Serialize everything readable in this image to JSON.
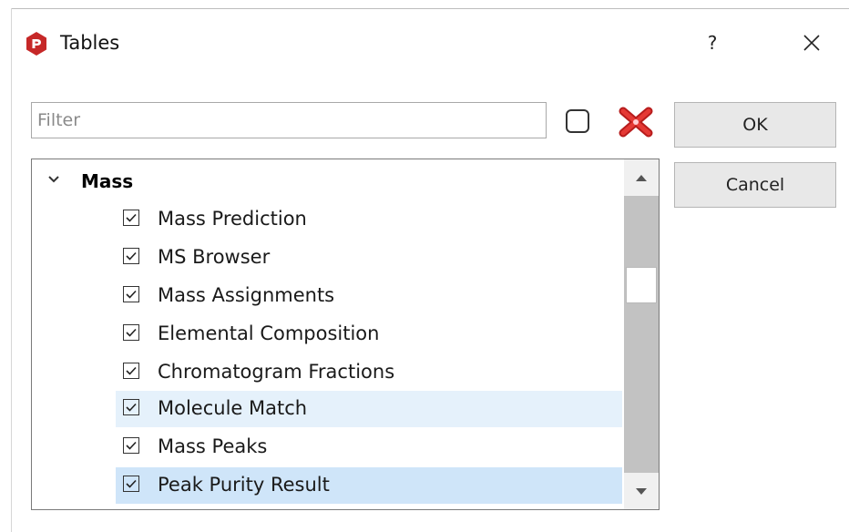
{
  "dialog": {
    "title": "Tables",
    "help_label": "?",
    "colors": {
      "app_icon": "#c62828",
      "delete_icon": "#c62828",
      "selection": "#cfe5f9",
      "hover": "#e5f1fb"
    }
  },
  "filter": {
    "value": "",
    "placeholder": "Filter"
  },
  "buttons": {
    "ok_label": "OK",
    "cancel_label": "Cancel"
  },
  "tree": {
    "group_label": "Mass",
    "group_expanded": true,
    "items": [
      {
        "label": "Mass Prediction",
        "checked": true,
        "state": "normal"
      },
      {
        "label": "MS Browser",
        "checked": true,
        "state": "normal"
      },
      {
        "label": "Mass Assignments",
        "checked": true,
        "state": "normal"
      },
      {
        "label": "Elemental Composition",
        "checked": true,
        "state": "normal"
      },
      {
        "label": "Chromatogram Fractions",
        "checked": true,
        "state": "normal"
      },
      {
        "label": "Molecule Match",
        "checked": true,
        "state": "hover"
      },
      {
        "label": "Mass Peaks",
        "checked": true,
        "state": "normal"
      },
      {
        "label": "Peak Purity Result",
        "checked": true,
        "state": "selected"
      }
    ]
  },
  "icons": {
    "app": "app-logo-icon",
    "close": "close-icon",
    "clear_selection": "checkbox-toggle-icon",
    "delete": "delete-x-icon",
    "expand": "chevron-down-icon",
    "scroll_up": "arrow-up-icon",
    "scroll_down": "arrow-down-icon"
  }
}
